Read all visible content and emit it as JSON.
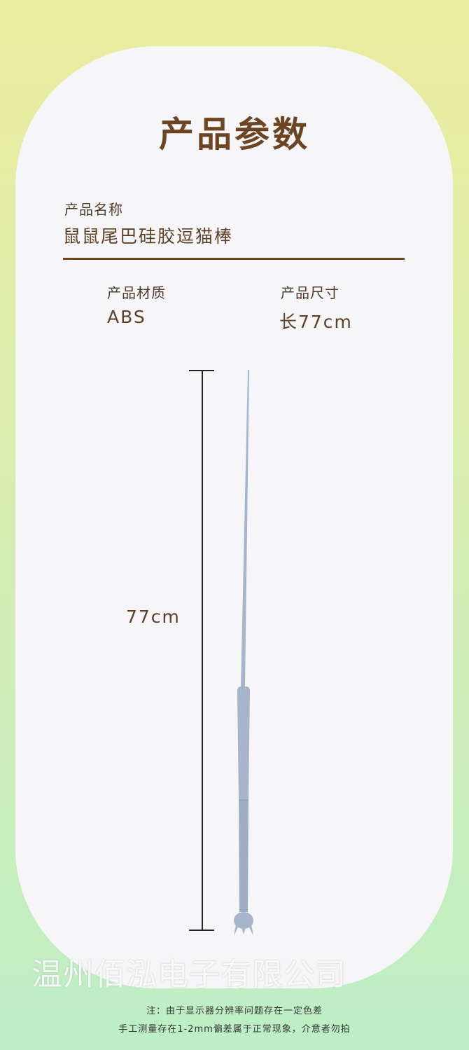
{
  "title": "产品参数",
  "product_name": {
    "label": "产品名称",
    "value": "鼠鼠尾巴硅胶逗猫棒"
  },
  "material": {
    "label": "产品材质",
    "value": "ABS"
  },
  "size": {
    "label": "产品尺寸",
    "value": "长77cm"
  },
  "dimension_label": "77cm",
  "watermark": "温州佰泓电子有限公司",
  "note_line1": "注：由于显示器分辨率问题存在一定色差",
  "note_line2": "手工测量存在1-2mm偏差属于正常现象，介意者勿拍",
  "colors": {
    "title": "#6b4524",
    "wand": "#a7b4c9",
    "card": "#f6f6f8"
  }
}
